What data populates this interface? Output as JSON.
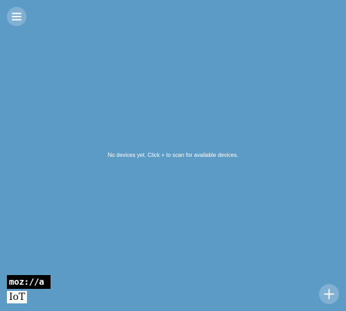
{
  "header": {
    "menu_icon": "hamburger-menu-icon"
  },
  "main": {
    "empty_message": "No devices yet. Click + to scan for available devices."
  },
  "logo": {
    "wordmark": "moz://a",
    "product": "IoT"
  },
  "actions": {
    "add_icon": "plus-icon"
  },
  "colors": {
    "background": "#5d9bc7",
    "text": "#ffffff"
  }
}
